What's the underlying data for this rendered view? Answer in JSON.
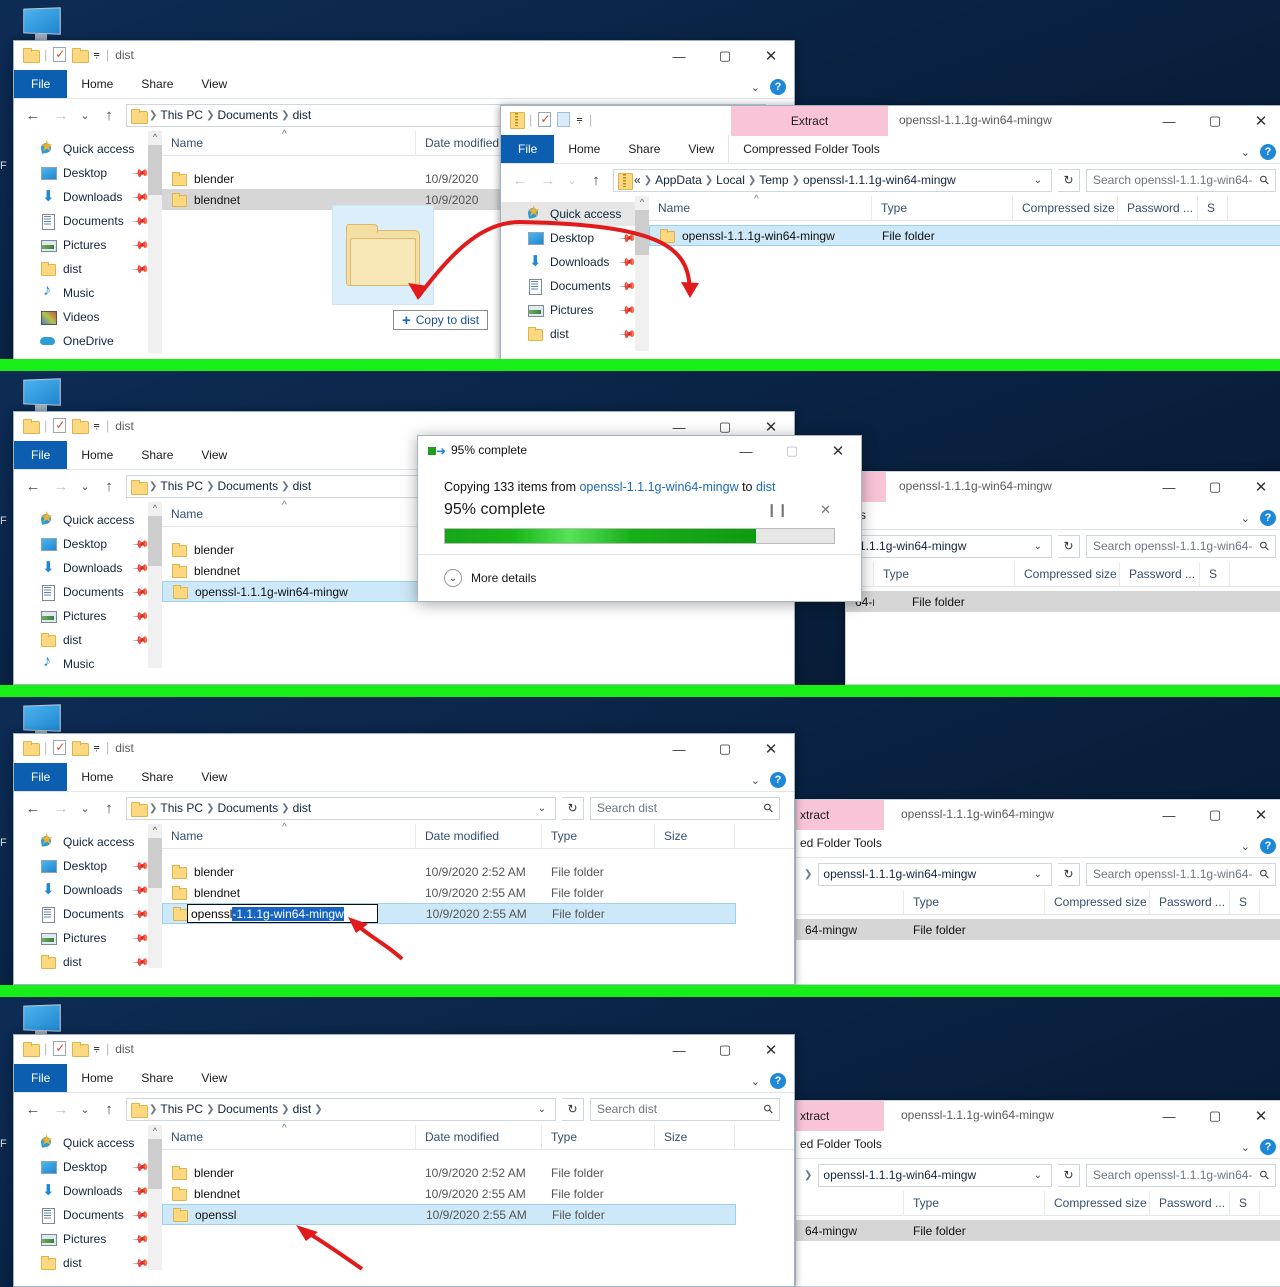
{
  "meta": {
    "accent_blue": "#0c5fb0",
    "selection_blue": "#cde8f8",
    "green_divider": "#18ef18",
    "arrow_red": "#e11b1b",
    "desktop_label": "F"
  },
  "desktop_icon": {
    "name": "this-pc-icon"
  },
  "explorer_common": {
    "ribbon_tabs": [
      "File",
      "Home",
      "Share",
      "View"
    ],
    "nav": {
      "back": "←",
      "forward": "→",
      "recent": "⌄",
      "up": "↑"
    },
    "columns_dist": [
      "Name",
      "Date modified",
      "Type",
      "Size"
    ],
    "columns_zip": [
      "Name",
      "Type",
      "Compressed size",
      "Password ...",
      "S"
    ],
    "sidebar": [
      {
        "label": "Quick access",
        "icon": "quick-access-star-icon",
        "pinned": false
      },
      {
        "label": "Desktop",
        "icon": "desktop-icon",
        "pinned": true
      },
      {
        "label": "Downloads",
        "icon": "downloads-icon",
        "pinned": true
      },
      {
        "label": "Documents",
        "icon": "documents-icon",
        "pinned": true
      },
      {
        "label": "Pictures",
        "icon": "pictures-icon",
        "pinned": true
      },
      {
        "label": "dist",
        "icon": "folder-icon",
        "pinned": true
      },
      {
        "label": "Music",
        "icon": "music-icon",
        "pinned": false
      },
      {
        "label": "Videos",
        "icon": "videos-icon",
        "pinned": false
      },
      {
        "label": "OneDrive",
        "icon": "onedrive-icon",
        "pinned": false
      }
    ]
  },
  "panel1": {
    "dist_window": {
      "title": "dist",
      "breadcrumb": [
        "This PC",
        "Documents",
        "dist"
      ],
      "rows": [
        {
          "name": "blender",
          "date": "10/9/2020",
          "type": "",
          "size": "",
          "state": "normal"
        },
        {
          "name": "blendnet",
          "date": "10/9/2020",
          "type": "",
          "size": "",
          "state": "selected-gray"
        }
      ]
    },
    "drag": {
      "ghost_name": "drag-folder-ghost",
      "tooltip": "Copy to dist",
      "tooltip_plus": "+"
    },
    "zip_window": {
      "title": "openssl-1.1.1g-win64-mingw",
      "context_group": "Extract",
      "context_tab": "Compressed Folder Tools",
      "breadcrumb": [
        "«",
        "AppData",
        "Local",
        "Temp",
        "openssl-1.1.1g-win64-mingw"
      ],
      "search_placeholder": "Search openssl-1.1.1g-win64-...",
      "rows": [
        {
          "name": "openssl-1.1.1g-win64-mingw",
          "type": "File folder",
          "state": "selected"
        }
      ]
    }
  },
  "panel2": {
    "dist_window": {
      "title": "dist",
      "breadcrumb": [
        "This PC",
        "Documents",
        "dist"
      ],
      "rows": [
        {
          "name": "blender",
          "state": "normal"
        },
        {
          "name": "blendnet",
          "state": "normal"
        },
        {
          "name": "openssl-1.1.1g-win64-mingw",
          "state": "selected"
        }
      ]
    },
    "copy_dialog": {
      "title": "95% complete",
      "line1_prefix": "Copying 133 items from ",
      "line1_source": "openssl-1.1.1g-win64-mingw",
      "line1_mid": " to ",
      "line1_dest": "dist",
      "percent_label": "95% complete",
      "percent_value": 95,
      "pause_label": "❙❙",
      "cancel_label": "✕",
      "more_details": "More details",
      "minimize": "—",
      "maximize": "▫",
      "close": "✕"
    },
    "zip_window": {
      "title": "openssl-1.1.1g-win64-mingw",
      "breadcrumb_tail": "1.1.1g-win64-mingw",
      "search_placeholder": "Search openssl-1.1.1g-win64-...",
      "rows": [
        {
          "name": "64-mingw",
          "type": "File folder",
          "state": "selected-gray"
        }
      ]
    }
  },
  "panel3": {
    "dist_window": {
      "title": "dist",
      "breadcrumb": [
        "This PC",
        "Documents",
        "dist"
      ],
      "search_placeholder": "Search dist",
      "rows": [
        {
          "name": "blender",
          "date": "10/9/2020 2:52 AM",
          "type": "File folder",
          "size": "",
          "state": "normal"
        },
        {
          "name": "blendnet",
          "date": "10/9/2020 2:55 AM",
          "type": "File folder",
          "size": "",
          "state": "normal"
        },
        {
          "name": "openssl-1.1.1g-win64-mingw",
          "date": "10/9/2020 2:55 AM",
          "type": "File folder",
          "size": "",
          "state": "renaming"
        }
      ],
      "rename": {
        "kept_text": "openssl",
        "selected_text": "-1.1.1g-win64-mingw"
      }
    },
    "zip_window": {
      "context_group": "xtract",
      "context_tab": "ed Folder Tools",
      "title": "openssl-1.1.1g-win64-mingw",
      "breadcrumb_tail": "openssl-1.1.1g-win64-mingw",
      "search_placeholder": "Search openssl-1.1.1g-win64-...",
      "rows": [
        {
          "name": "64-mingw",
          "type": "File folder",
          "state": "selected-gray"
        }
      ]
    }
  },
  "panel4": {
    "dist_window": {
      "title": "dist",
      "breadcrumb": [
        "This PC",
        "Documents",
        "dist",
        ""
      ],
      "search_placeholder": "Search dist",
      "rows": [
        {
          "name": "blender",
          "date": "10/9/2020 2:52 AM",
          "type": "File folder",
          "size": "",
          "state": "normal"
        },
        {
          "name": "blendnet",
          "date": "10/9/2020 2:55 AM",
          "type": "File folder",
          "size": "",
          "state": "normal"
        },
        {
          "name": "openssl",
          "date": "10/9/2020 2:55 AM",
          "type": "File folder",
          "size": "",
          "state": "selected"
        }
      ]
    },
    "zip_window": {
      "context_group": "xtract",
      "context_tab": "ed Folder Tools",
      "title": "openssl-1.1.1g-win64-mingw",
      "breadcrumb_tail": "openssl-1.1.1g-win64-mingw",
      "search_placeholder": "Search openssl-1.1.1g-win64-...",
      "rows": [
        {
          "name": "64-mingw",
          "type": "File folder",
          "state": "selected-gray"
        }
      ]
    }
  }
}
